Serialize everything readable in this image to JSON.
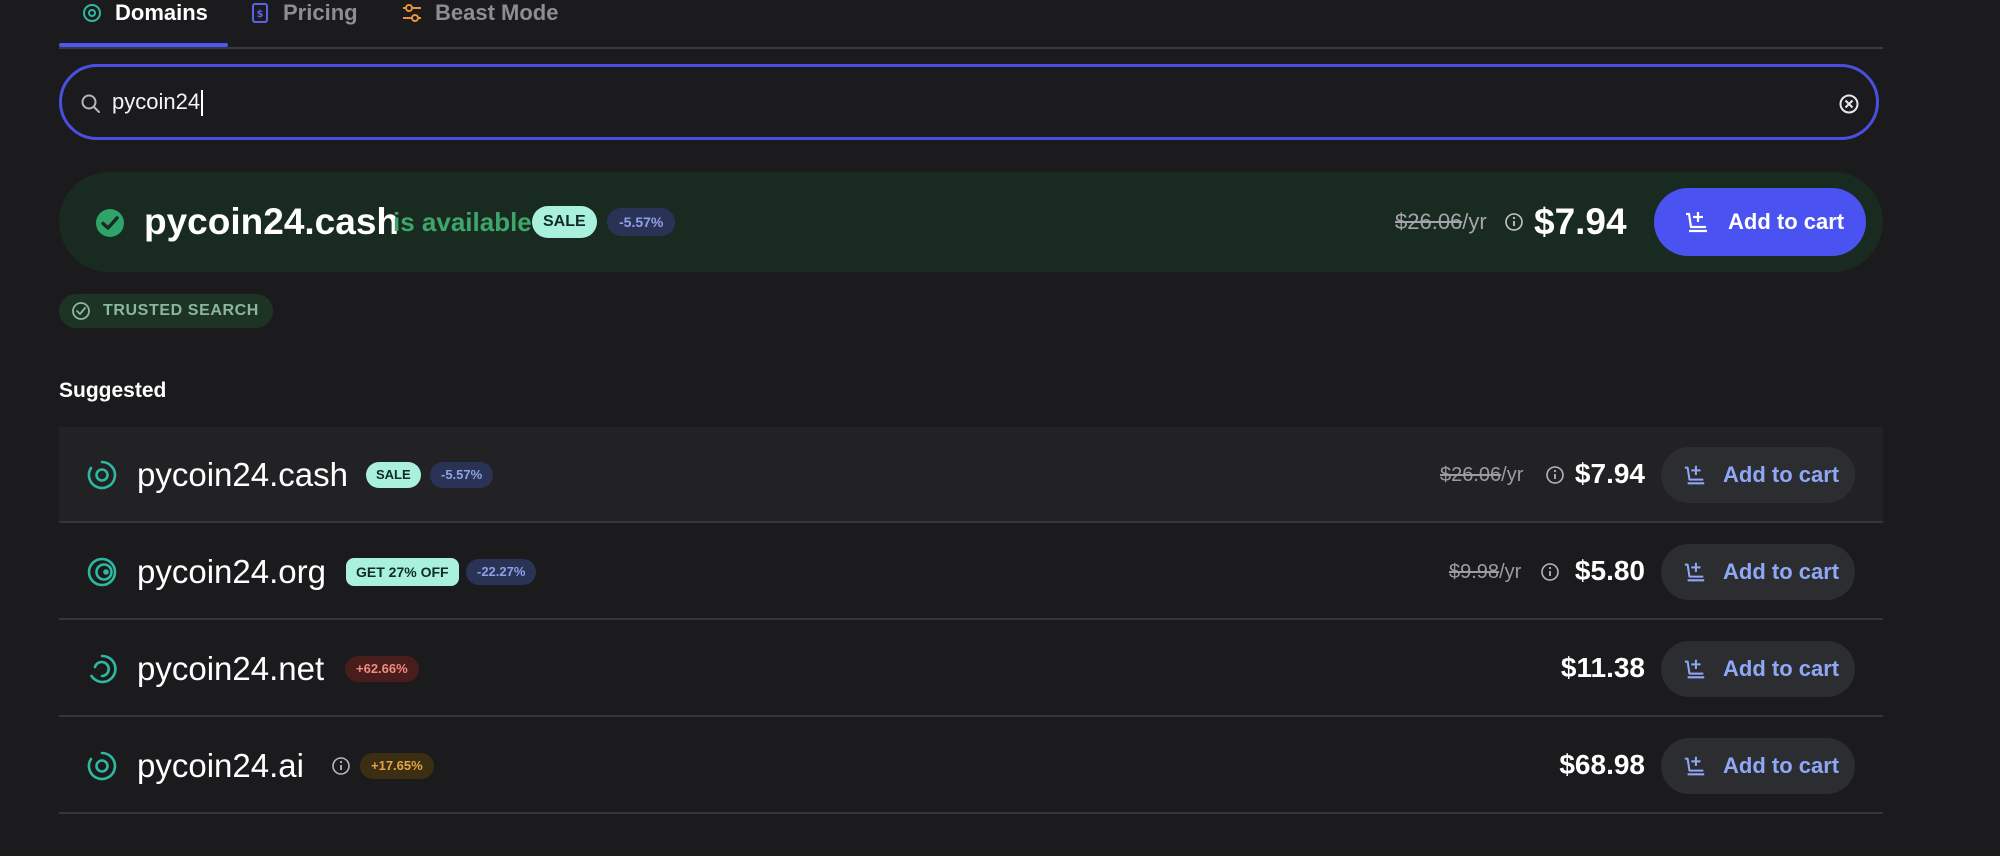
{
  "tabs": [
    {
      "label": "Domains",
      "icon": "target-icon"
    },
    {
      "label": "Pricing",
      "icon": "price-tag-icon"
    },
    {
      "label": "Beast Mode",
      "icon": "sliders-icon"
    }
  ],
  "search": {
    "value": "pycoin24"
  },
  "hero": {
    "domain": "pycoin24.cash",
    "status": "is available",
    "sale_badge": "SALE",
    "pct_badge": "-5.57%",
    "old_price": "$26.06",
    "period": "/yr",
    "price": "$7.94",
    "cart_label": "Add to cart"
  },
  "trusted": {
    "label": "TRUSTED SEARCH"
  },
  "suggested_title": "Suggested",
  "suggestions": [
    {
      "domain": "pycoin24.cash",
      "badge": "SALE",
      "pct": "-5.57%",
      "old_price": "$26.06",
      "period": "/yr",
      "price": "$7.94",
      "cart_label": "Add to cart"
    },
    {
      "domain": "pycoin24.org",
      "badge": "GET 27% OFF",
      "pct": "-22.27%",
      "old_price": "$9.98",
      "period": "/yr",
      "price": "$5.80",
      "cart_label": "Add to cart"
    },
    {
      "domain": "pycoin24.net",
      "pct": "+62.66%",
      "price": "$11.38",
      "cart_label": "Add to cart"
    },
    {
      "domain": "pycoin24.ai",
      "pct": "+17.65%",
      "price": "$68.98",
      "cart_label": "Add to cart"
    }
  ],
  "colors": {
    "accent": "#4a53f1",
    "available": "#3ea66a",
    "sale_badge": "#a9f1dc",
    "background": "#1b1b1d"
  }
}
